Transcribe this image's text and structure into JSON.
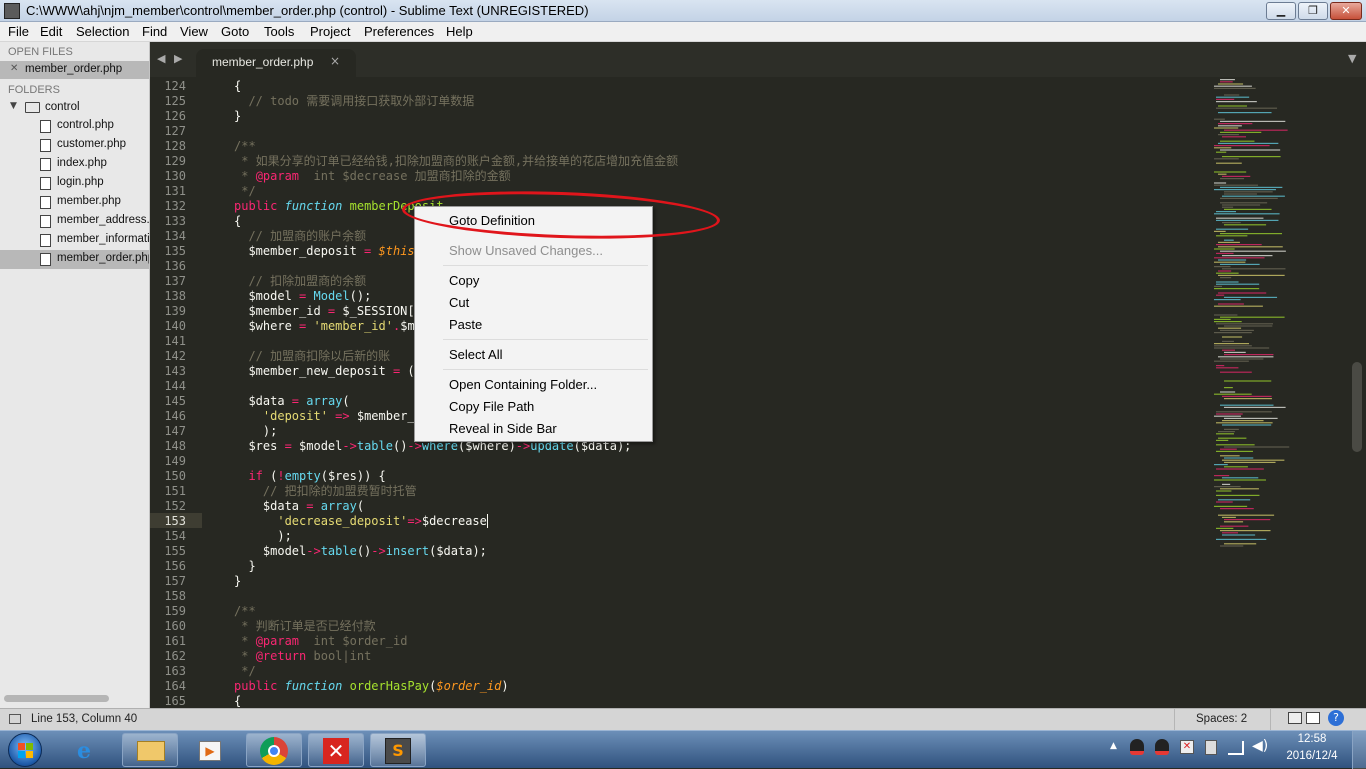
{
  "window": {
    "title": "C:\\WWW\\ahj\\njm_member\\control\\member_order.php (control) - Sublime Text (UNREGISTERED)",
    "minimize_label": "▁",
    "maximize_label": "❐",
    "close_label": "✕"
  },
  "menubar": [
    "File",
    "Edit",
    "Selection",
    "Find",
    "View",
    "Goto",
    "Tools",
    "Project",
    "Preferences",
    "Help"
  ],
  "sidebar": {
    "open_files_header": "OPEN FILES",
    "open_files": [
      {
        "close": "✕",
        "label": "member_order.php"
      }
    ],
    "folders_header": "FOLDERS",
    "folder_name": "control",
    "files": [
      "control.php",
      "customer.php",
      "index.php",
      "login.php",
      "member.php",
      "member_address.php",
      "member_information.php",
      "member_order.php"
    ]
  },
  "tabs": [
    {
      "label": "member_order.php",
      "close": "×"
    }
  ],
  "nav_arrows": {
    "left": "◀",
    "right": "▶"
  },
  "tab_dropdown": "▼",
  "editor": {
    "line_numbers": [
      "124",
      "125",
      "126",
      "127",
      "128",
      "129",
      "130",
      "131",
      "132",
      "133",
      "134",
      "135",
      "136",
      "137",
      "138",
      "139",
      "140",
      "141",
      "142",
      "143",
      "144",
      "145",
      "146",
      "147",
      "148",
      "149",
      "150",
      "151",
      "152",
      "153",
      "154",
      "155",
      "156",
      "157",
      "158",
      "159",
      "160",
      "161",
      "162",
      "163",
      "164",
      "165"
    ],
    "current_line": "153"
  },
  "context_menu": {
    "items": [
      {
        "label": "Goto Definition",
        "enabled": true
      },
      {
        "label": "Show Unsaved Changes...",
        "enabled": false
      },
      {
        "label": "Copy",
        "enabled": true
      },
      {
        "label": "Cut",
        "enabled": true
      },
      {
        "label": "Paste",
        "enabled": true
      },
      {
        "label": "Select All",
        "enabled": true
      },
      {
        "label": "Open Containing Folder...",
        "enabled": true
      },
      {
        "label": "Copy File Path",
        "enabled": true
      },
      {
        "label": "Reveal in Side Bar",
        "enabled": true
      }
    ]
  },
  "statusbar": {
    "position": "Line 153, Column 40",
    "indent": "Spaces: 2"
  },
  "taskbar": {
    "time": "12:58",
    "date": "2016/12/4",
    "apps": [
      "start",
      "internet-explorer",
      "file-explorer",
      "media-player",
      "chrome",
      "xmind",
      "sublime-text"
    ]
  },
  "colors": {
    "editor_bg": "#272822",
    "comment": "#75715e",
    "keyword": "#66d9ef",
    "string": "#e6db74",
    "operator": "#f92672",
    "function": "#a6e22e",
    "param": "#fd971f",
    "annotation": "#e0151b"
  }
}
